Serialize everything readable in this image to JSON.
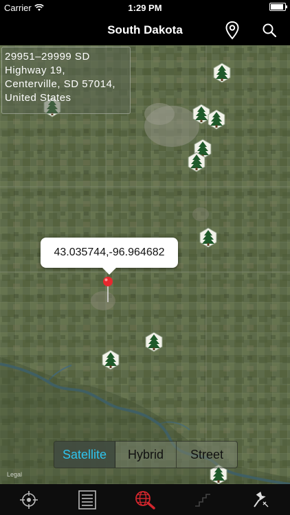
{
  "status_bar": {
    "carrier": "Carrier",
    "time": "1:29 PM"
  },
  "nav_bar": {
    "title": "South Dakota",
    "pin_icon": "map-pin-icon",
    "search_icon": "search-icon"
  },
  "map": {
    "address": "29951–29999 SD\nHighway 19,\nCenterville, SD  57014,\nUnited States",
    "callout_coordinates": "43.035744,-96.964682",
    "legal_label": "Legal",
    "tree_marker_icon": "tree-icon",
    "tree_marker_count": 10,
    "map_type_options": [
      "Satellite",
      "Hybrid",
      "Street"
    ],
    "selected_map_type": "Satellite",
    "colors": {
      "selected_segment_text": "#2ec4ee",
      "pin": "#e8282e",
      "tree_marker": "#1f5a2a"
    }
  },
  "tab_bar": {
    "items": [
      {
        "icon": "crosshair-icon"
      },
      {
        "icon": "list-icon"
      },
      {
        "icon": "globe-search-icon"
      },
      {
        "icon": "elevation-icon"
      },
      {
        "icon": "pushpin-icon"
      }
    ],
    "selected_index": 2
  }
}
